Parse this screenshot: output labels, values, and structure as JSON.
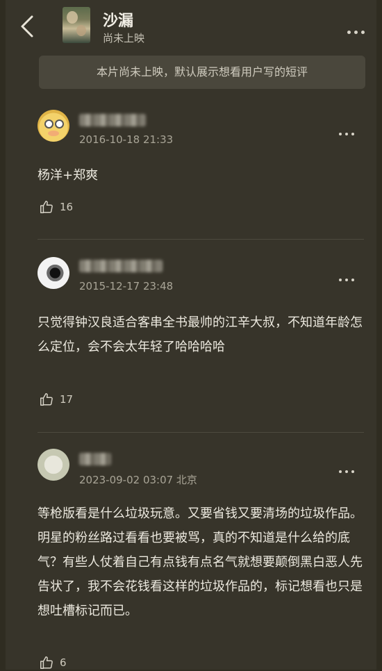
{
  "header": {
    "title": "沙漏",
    "status": "尚未上映"
  },
  "notice": "本片尚未上映，默认展示想看用户写的短评",
  "comments": [
    {
      "timestamp": "2016-10-18 21:33",
      "text": "杨洋+郑爽",
      "likes": "16"
    },
    {
      "timestamp": "2015-12-17 23:48",
      "text": "只觉得钟汉良适合客串全书最帅的江辛大叔，不知道年龄怎么定位，会不会太年轻了哈哈哈哈",
      "likes": "17"
    },
    {
      "timestamp": "2023-09-02 03:07 北京",
      "text": "等枪版看是什么垃圾玩意。又要省钱又要清场的垃圾作品。明星的粉丝路过看看也要被骂，真的不知道是什么给的底气？有些人仗着自己有点钱有点名气就想要颠倒黑白恶人先告状了，我不会花钱看这样的垃圾作品的，标记想看也只是想吐槽标记而已。",
      "likes": "6"
    }
  ],
  "icons": {
    "back": "chevron-left-icon",
    "more": "more-dots-icon",
    "like": "thumbs-up-icon"
  }
}
